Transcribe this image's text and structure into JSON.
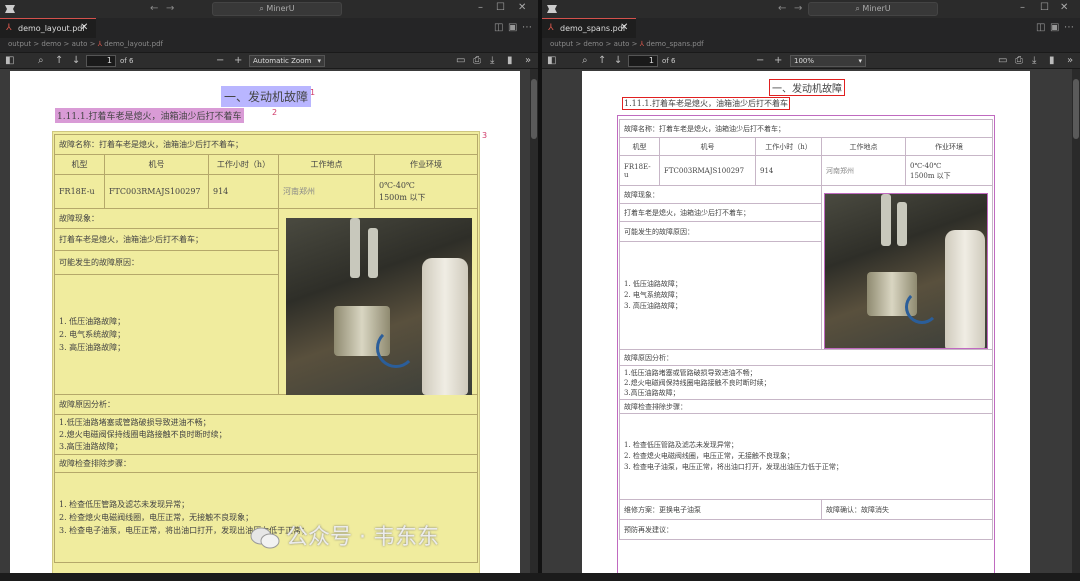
{
  "app_title": "MinerU",
  "nav_arrows": {
    "back": "←",
    "forward": "→"
  },
  "window_controls": {
    "minimize": "–",
    "maximize": "☐",
    "close": "✕"
  },
  "windows": [
    {
      "tab_name": "demo_layout.pdf",
      "breadcrumb": [
        "output",
        "demo",
        "auto",
        "demo_layout.pdf"
      ],
      "page_number": "1",
      "page_count": "of 6",
      "zoom": "Automatic Zoom"
    },
    {
      "tab_name": "demo_spans.pdf",
      "breadcrumb": [
        "output",
        "demo",
        "auto",
        "demo_spans.pdf"
      ],
      "page_number": "1",
      "page_count": "of 6",
      "zoom": "100%"
    }
  ],
  "doc": {
    "title": "一、发动机故障",
    "subtitle": "1.11.1.打着车老是熄火，油箱油少后打不着车",
    "fault_name": "故障名称：打着车老是熄火，油箱油少后打不着车；",
    "headers": [
      "机型",
      "机号",
      "工作小时（h）",
      "工作地点",
      "作业环境"
    ],
    "row": [
      "FR18E-u",
      "FTC003RMAJS100297",
      "914",
      "河南郑州",
      "0℃-40℃\n1500m 以下"
    ],
    "phenomenon_label": "故障现象：",
    "phenomenon": "打着车老是熄火，油箱油少后打不着车；",
    "causes_label": "可能发生的故障原因：",
    "causes": [
      "1. 低压油路故障；",
      "2. 电气系统故障；",
      "3. 高压油路故障；"
    ],
    "analysis_label": "故障原因分析：",
    "analysis": [
      "1.低压油路堵塞或管路破损导致进油不畅；",
      "2.熄火电磁阀保持线圈电路接触不良时断时续；",
      "3.高压油路故障；"
    ],
    "steps_label": "故障检查排除步骤：",
    "steps": [
      "1. 检查低压管路及滤芯未发现异常；",
      "2. 检查熄火电磁阀线圈，电压正常，无接触不良现象；",
      "3. 检查电子油泵，电压正常，将出油口打开，发现出油压力低于正常；"
    ],
    "repair": "维修方案：更换电子油泵",
    "confirm": "故障确认：故障消失",
    "prevention": "预防再发建议："
  },
  "layout_labels": [
    "1",
    "2",
    "3"
  ],
  "watermark": "公众号 · 韦东东",
  "colors": {
    "title_box": "#b9b6ff",
    "subtitle_box": "#d99bd6",
    "table_box": "#f0ec9e",
    "span_box": "#e02020"
  }
}
